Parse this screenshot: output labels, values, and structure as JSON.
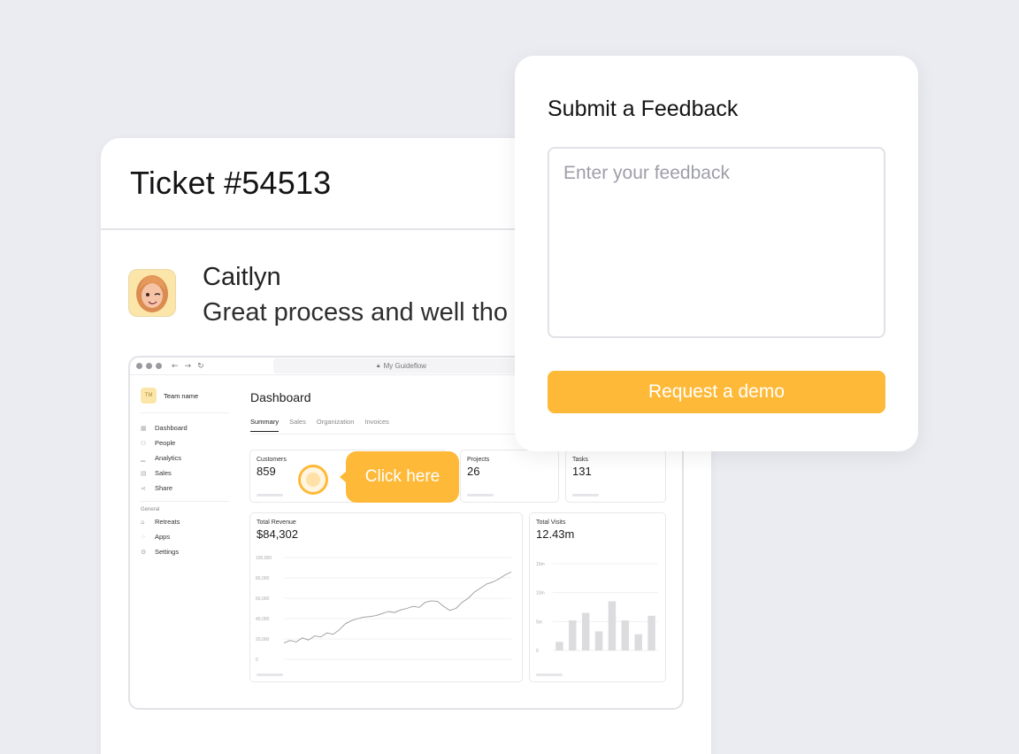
{
  "ticket": {
    "title": "Ticket #54513",
    "message": {
      "author": "Caitlyn",
      "text": "Great process and well tho"
    }
  },
  "embedded_app": {
    "url": "My Guideflow",
    "team": {
      "badge": "TM",
      "name": "Team name"
    },
    "nav": {
      "items": [
        "Dashboard",
        "People",
        "Analytics",
        "Sales",
        "Share"
      ],
      "group_label": "General",
      "group_items": [
        "Retreats",
        "Apps",
        "Settings"
      ]
    },
    "page_title": "Dashboard",
    "tabs": [
      "Summary",
      "Sales",
      "Organization",
      "Invoices"
    ],
    "active_tab": "Summary",
    "stats": [
      {
        "label": "Customers",
        "value": "859"
      },
      {
        "label": "Projects",
        "value": "26"
      },
      {
        "label": "Tasks",
        "value": "131"
      }
    ],
    "revenue": {
      "label": "Total Revenue",
      "value": "$84,302"
    },
    "visits": {
      "label": "Total Visits",
      "value": "12.43m"
    },
    "tooltip": "Click here"
  },
  "chart_data": [
    {
      "type": "line",
      "title": "Total Revenue",
      "y_ticks": [
        "100,000",
        "80,000",
        "60,000",
        "40,000",
        "20,000",
        "0"
      ],
      "ylim": [
        0,
        100000
      ],
      "values": [
        16000,
        18500,
        17000,
        21000,
        19000,
        23000,
        22000,
        26000,
        24500,
        29000,
        35000,
        38000,
        40000,
        41500,
        42000,
        43000,
        45000,
        47000,
        46000,
        48500,
        50000,
        52000,
        51000,
        56000,
        57500,
        57000,
        52000,
        48000,
        50000,
        56000,
        60000,
        66000,
        70000,
        74000,
        76000,
        79000,
        83000,
        86000
      ]
    },
    {
      "type": "bar",
      "title": "Total Visits",
      "y_ticks": [
        "15m",
        "10m",
        "5m",
        "0"
      ],
      "ylim": [
        0,
        15
      ],
      "values": [
        1.5,
        5.2,
        6.5,
        3.3,
        8.5,
        5.2,
        2.8,
        6.0
      ]
    }
  ],
  "feedback": {
    "title": "Submit a Feedback",
    "placeholder": "Enter your feedback",
    "button": "Request a demo"
  },
  "colors": {
    "accent": "#ffb938",
    "background": "#ebecf1"
  }
}
